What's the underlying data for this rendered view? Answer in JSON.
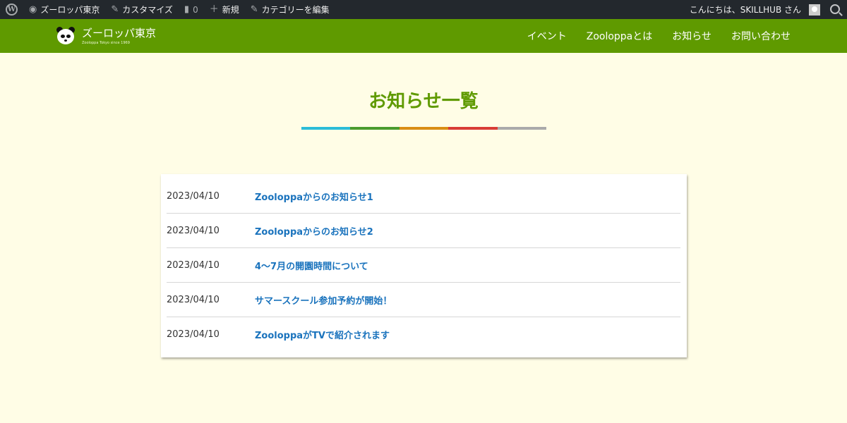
{
  "adminbar": {
    "site_name": "ズーロッパ東京",
    "customize": "カスタマイズ",
    "comments_count": "0",
    "new": "新規",
    "edit_category": "カテゴリーを編集",
    "greeting": "こんにちは、SKILLHUB さん",
    "colors": {
      "bg": "#23282d"
    }
  },
  "header": {
    "site_name": "ズーロッパ東京",
    "tagline": "Zooloppa Tokyo since 1969",
    "nav": [
      {
        "label": "イベント"
      },
      {
        "label": "Zooloppaとは"
      },
      {
        "label": "お知らせ"
      },
      {
        "label": "お問い合わせ"
      }
    ],
    "colors": {
      "bg": "#5f9a00"
    }
  },
  "main": {
    "title": "お知らせ一覧",
    "title_bar_colors": [
      "#2bbcd8",
      "#4a9c2d",
      "#d98e14",
      "#d83c36",
      "#aaaaaa"
    ],
    "news": [
      {
        "date": "2023/04/10",
        "title": "Zooloppaからのお知らせ1"
      },
      {
        "date": "2023/04/10",
        "title": "Zooloppaからのお知らせ2"
      },
      {
        "date": "2023/04/10",
        "title": "4～7月の開園時間について"
      },
      {
        "date": "2023/04/10",
        "title": "サマースクール参加予約が開始！"
      },
      {
        "date": "2023/04/10",
        "title": "ZooloppaがTVで紹介されます"
      }
    ]
  }
}
